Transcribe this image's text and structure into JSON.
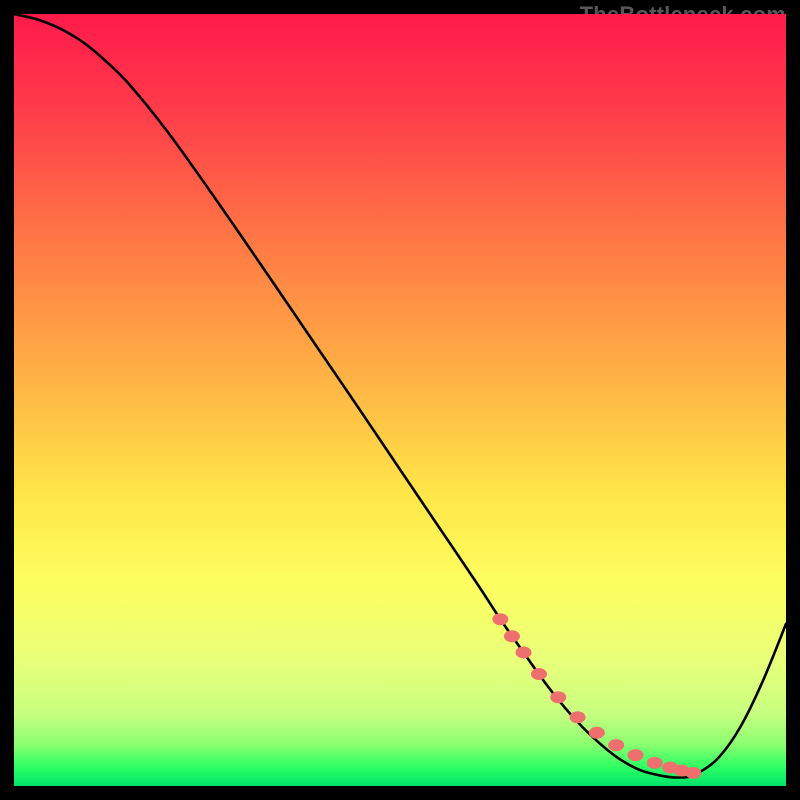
{
  "watermark": "TheBottleneck.com",
  "chart_data": {
    "type": "line",
    "title": "",
    "xlabel": "",
    "ylabel": "",
    "xlim": [
      0,
      100
    ],
    "ylim": [
      0,
      100
    ],
    "gradient_stops": [
      {
        "offset": 0.0,
        "color": "#ff1a4b"
      },
      {
        "offset": 0.12,
        "color": "#ff3a4a"
      },
      {
        "offset": 0.3,
        "color": "#ff7a45"
      },
      {
        "offset": 0.48,
        "color": "#ffb545"
      },
      {
        "offset": 0.62,
        "color": "#ffe648"
      },
      {
        "offset": 0.74,
        "color": "#fdff60"
      },
      {
        "offset": 0.84,
        "color": "#e8ff7a"
      },
      {
        "offset": 0.905,
        "color": "#c8ff80"
      },
      {
        "offset": 0.945,
        "color": "#8dff70"
      },
      {
        "offset": 0.975,
        "color": "#2eff63"
      },
      {
        "offset": 1.0,
        "color": "#00e46a"
      }
    ],
    "series": [
      {
        "name": "curve",
        "x": [
          0,
          3,
          6,
          9,
          12,
          15,
          20,
          26,
          32,
          38,
          44,
          50,
          55,
          60,
          63,
          66,
          69,
          72,
          75,
          78,
          81,
          84,
          86,
          88,
          91,
          94,
          97,
          100
        ],
        "y": [
          100,
          99.3,
          98.1,
          96.3,
          93.8,
          90.8,
          84.6,
          76.2,
          67.5,
          58.7,
          49.9,
          41.0,
          33.6,
          26.2,
          21.6,
          17.3,
          13.1,
          9.4,
          6.3,
          3.8,
          2.1,
          1.3,
          1.1,
          1.4,
          3.4,
          7.5,
          13.6,
          21.0
        ]
      }
    ],
    "markers": {
      "name": "dotted-segment",
      "color": "#ef6f6f",
      "x": [
        63.0,
        64.5,
        66.0,
        68.0,
        70.5,
        73.0,
        75.5,
        78.0,
        80.5,
        83.0,
        85.0,
        86.5,
        88.0
      ],
      "y": [
        21.6,
        19.4,
        17.3,
        14.5,
        11.5,
        8.9,
        6.9,
        5.3,
        4.0,
        3.0,
        2.4,
        2.0,
        1.7
      ]
    }
  }
}
